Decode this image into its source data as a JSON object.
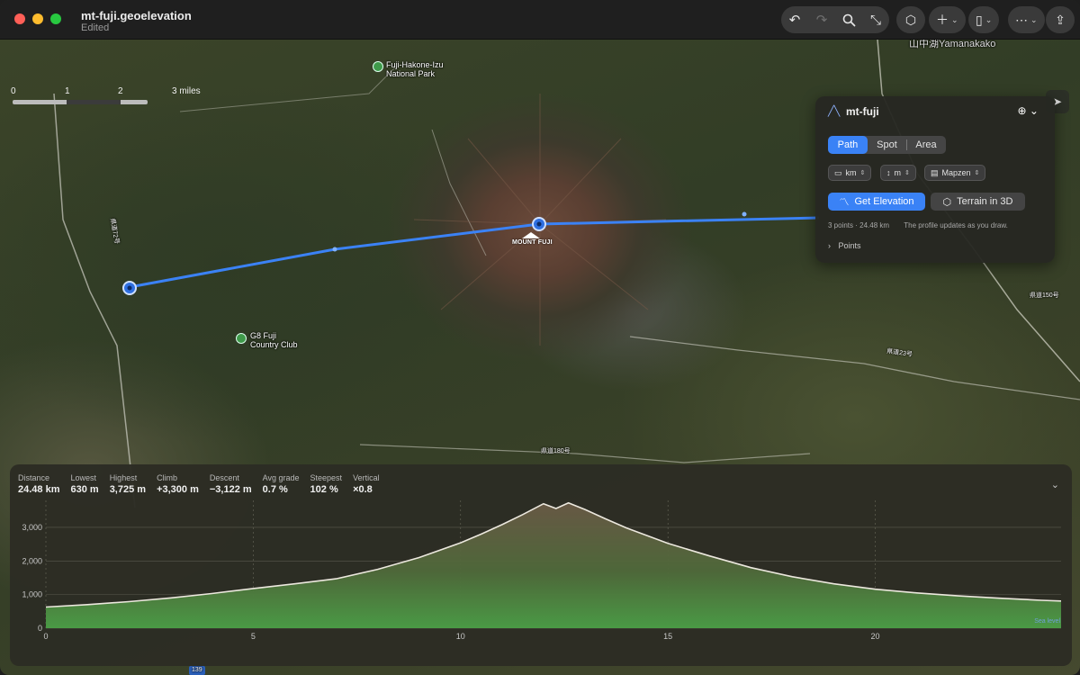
{
  "window": {
    "title": "mt-fuji.geoelevation",
    "subtitle": "Edited"
  },
  "toolbar": {
    "icons": [
      "undo-icon",
      "redo-icon",
      "search-icon",
      "expand-icon",
      "cube-icon",
      "plus-icon",
      "map-icon",
      "more-icon",
      "share-icon"
    ]
  },
  "map": {
    "scale": {
      "labels": [
        "0",
        "1",
        "2",
        "3 miles"
      ]
    },
    "labels": {
      "park_line1": "Fuji-Hakone-Izu",
      "park_line2": "National Park",
      "club_line1": "G8 Fuji",
      "club_line2": "Country Club",
      "peak": "MOUNT FUJI",
      "route_left": "県道72号",
      "route_mid": "県道23号",
      "route_bottom": "県道180号",
      "route_right": "県道150号",
      "place_top": "山中湖",
      "place_top_right": "Yamanakako",
      "road_shield": "139"
    }
  },
  "inspector": {
    "title": "mt-fuji",
    "modes": {
      "path": "Path",
      "spot": "Spot",
      "area": "Area",
      "active": "Path"
    },
    "units": {
      "distance": "km",
      "elevation": "m",
      "source": "Mapzen"
    },
    "get_elevation": "Get Elevation",
    "terrain_3d": "Terrain in 3D",
    "info_points": "3 points · 24.48 km",
    "info_hint": "The profile updates as you draw.",
    "points_label": "Points"
  },
  "profile": {
    "stats": [
      {
        "label": "Distance",
        "value": "24.48 km"
      },
      {
        "label": "Lowest",
        "value": "630 m"
      },
      {
        "label": "Highest",
        "value": "3,725 m"
      },
      {
        "label": "Climb",
        "value": "+3,300 m"
      },
      {
        "label": "Descent",
        "value": "−3,122 m"
      },
      {
        "label": "Avg grade",
        "value": "0.7 %"
      },
      {
        "label": "Steepest",
        "value": "102 %"
      },
      {
        "label": "Vertical",
        "value": "×0.8"
      }
    ],
    "sea_level_label": "Sea level"
  },
  "chart_data": {
    "type": "area",
    "x_label": "",
    "y_label": "",
    "xlim": [
      0,
      24.48
    ],
    "ylim": [
      0,
      3800
    ],
    "x_ticks": [
      0,
      5,
      10,
      15,
      20
    ],
    "y_ticks": [
      0,
      1000,
      2000,
      3000
    ],
    "y_tick_labels": [
      "0",
      "1,000",
      "2,000",
      "3,000"
    ],
    "x": [
      0,
      1,
      2,
      3,
      4,
      5,
      6,
      7,
      8,
      9,
      10,
      10.5,
      11,
      11.5,
      12,
      12.3,
      12.6,
      13,
      13.5,
      14,
      15,
      16,
      17,
      18,
      19,
      20,
      21,
      22,
      23,
      24,
      24.48
    ],
    "y": [
      630,
      700,
      790,
      900,
      1030,
      1180,
      1320,
      1470,
      1750,
      2100,
      2540,
      2800,
      3080,
      3380,
      3700,
      3560,
      3725,
      3530,
      3250,
      2980,
      2520,
      2150,
      1800,
      1530,
      1320,
      1160,
      1050,
      960,
      890,
      830,
      808
    ]
  }
}
